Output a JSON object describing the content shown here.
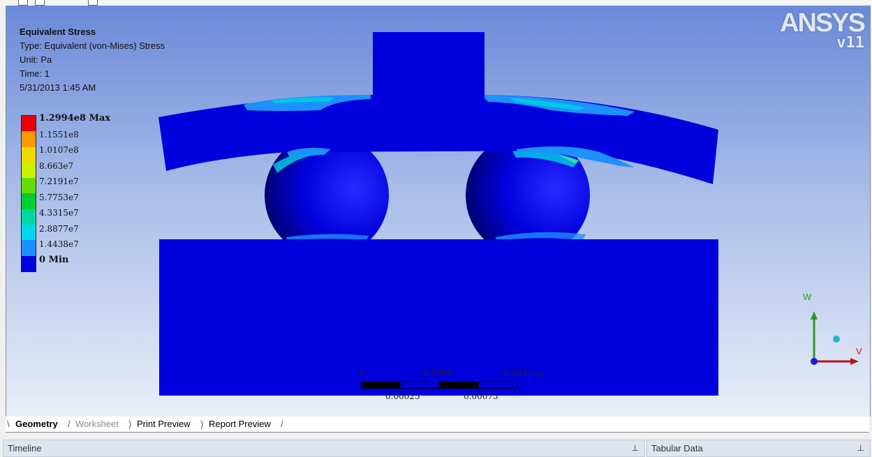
{
  "result": {
    "title": "Equivalent Stress",
    "type_line": "Type: Equivalent (von-Mises) Stress",
    "unit_line": "Unit: Pa",
    "time_line": "Time: 1",
    "date_line": "5/31/2013 1:45 AM"
  },
  "legend": {
    "levels": [
      {
        "label": "1.2994e8 Max",
        "color": "#e60000"
      },
      {
        "label": "1.1551e8",
        "color": "#ff9900"
      },
      {
        "label": "1.0107e8",
        "color": "#f0d800"
      },
      {
        "label": "8.663e7",
        "color": "#c8f000"
      },
      {
        "label": "7.2191e7",
        "color": "#66dd00"
      },
      {
        "label": "5.7753e7",
        "color": "#00cc33"
      },
      {
        "label": "4.3315e7",
        "color": "#00d8a0"
      },
      {
        "label": "2.8877e7",
        "color": "#00d8e8"
      },
      {
        "label": "1.4438e7",
        "color": "#1e90ff"
      },
      {
        "label": "0 Min",
        "color": "#0000dd"
      }
    ]
  },
  "logo": {
    "brand": "ANSYS",
    "version": "v11"
  },
  "triad": {
    "up_label": "W",
    "right_label": "V"
  },
  "scale": {
    "top_labels": [
      "0",
      "0.0005",
      "0.001 (m)"
    ],
    "bottom_labels": [
      "0.00025",
      "0.00075"
    ]
  },
  "tabs": [
    {
      "label": "Geometry",
      "state": "active"
    },
    {
      "label": "Worksheet",
      "state": "inactive"
    },
    {
      "label": "Print Preview",
      "state": "normal"
    },
    {
      "label": "Report Preview",
      "state": "normal"
    }
  ],
  "panels": {
    "timeline": "Timeline",
    "tabular": "Tabular Data",
    "pin_glyph": "⊥"
  },
  "colors": {
    "model_blue": "#0000dd",
    "stress_light": "#1e90ff",
    "stress_cyan": "#00c8e0"
  }
}
